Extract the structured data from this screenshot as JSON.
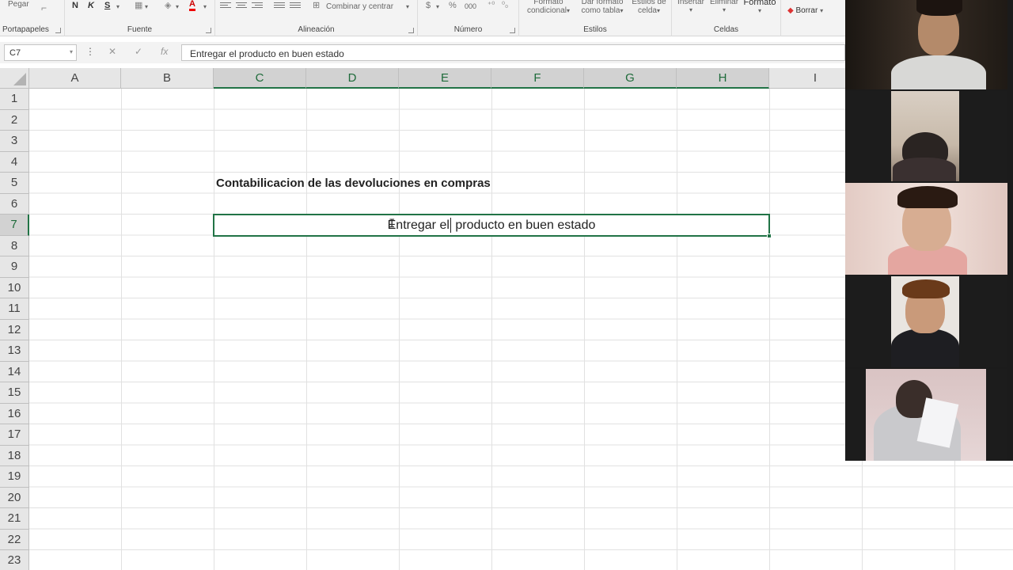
{
  "ribbon": {
    "clipboard": {
      "paste_label": "Pegar",
      "group_label": "Portapapeles"
    },
    "font": {
      "bold": "N",
      "italic": "K",
      "underline": "S",
      "font_color_letter": "A",
      "group_label": "Fuente"
    },
    "alignment": {
      "merge_label": "Combinar y centrar",
      "group_label": "Alineación"
    },
    "number": {
      "currency": "$",
      "percent": "%",
      "thousands": "000",
      "group_label": "Número"
    },
    "styles": {
      "conditional_format": [
        "Formato",
        "condicional"
      ],
      "format_as_table": [
        "Dar formato",
        "como tabla"
      ],
      "cell_styles": [
        "Estilos de",
        "celda"
      ],
      "group_label": "Estilos"
    },
    "cells": {
      "insert": "Insertar",
      "delete": "Eliminar",
      "format": "Formato",
      "group_label": "Celdas"
    },
    "editing": {
      "clear": "Borrar"
    }
  },
  "formula_bar": {
    "name_box": "C7",
    "cancel_icon": "✕",
    "enter_icon": "✓",
    "function_icon": "fx",
    "content": "Entregar el producto en buen estado"
  },
  "sheet": {
    "columns": [
      "A",
      "B",
      "C",
      "D",
      "E",
      "F",
      "G",
      "H",
      "I"
    ],
    "selected_columns": [
      "C",
      "D",
      "E",
      "F",
      "G",
      "H"
    ],
    "rows": [
      "1",
      "2",
      "3",
      "4",
      "5",
      "6",
      "7",
      "8",
      "9",
      "10",
      "11",
      "12",
      "13",
      "14",
      "15",
      "16",
      "17",
      "18",
      "19",
      "20",
      "21",
      "22",
      "23"
    ],
    "selected_row": "7",
    "cells": {
      "C5": "Contabilicacion de  las devoluciones en compras",
      "C7_before_caret": "Entregar el",
      "C7_after_caret": " producto en buen estado"
    },
    "accent_color": "#217346"
  },
  "video_call": {
    "participant_count": 5
  }
}
